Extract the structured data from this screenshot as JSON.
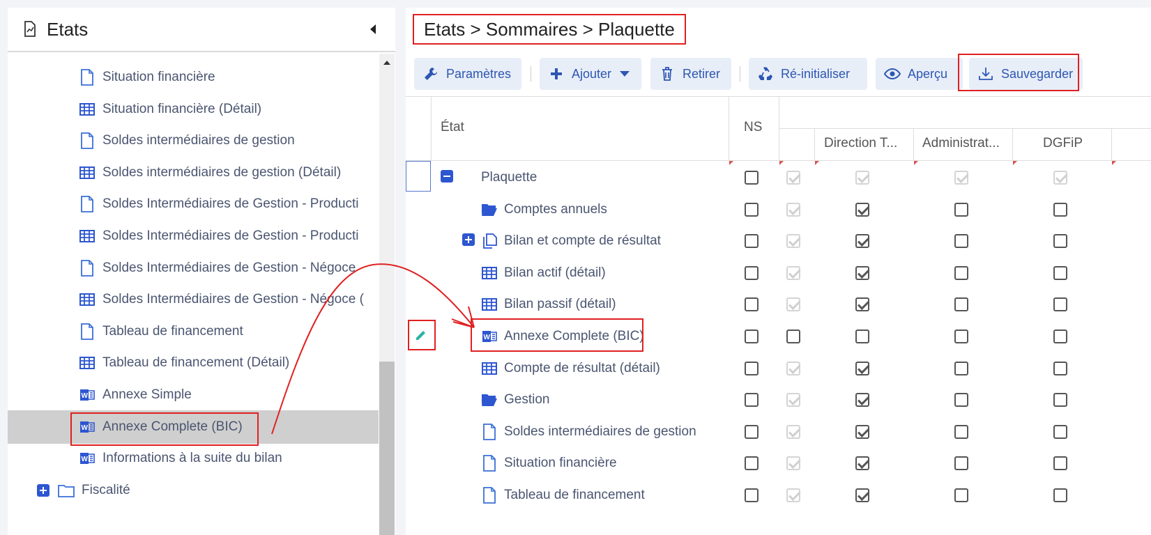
{
  "left_panel": {
    "title": "Etats",
    "items": [
      {
        "label": "Situation financière",
        "icon": "document-icon",
        "indent": 1
      },
      {
        "label": "Situation financière (Détail)",
        "icon": "table-icon",
        "indent": 1
      },
      {
        "label": "Soldes intermédiaires de gestion",
        "icon": "document-icon",
        "indent": 1
      },
      {
        "label": "Soldes intermédiaires de gestion (Détail)",
        "icon": "table-icon",
        "indent": 1
      },
      {
        "label": "Soldes Intermédiaires de Gestion - Producti",
        "icon": "document-icon",
        "indent": 1
      },
      {
        "label": "Soldes Intermédiaires de Gestion - Producti",
        "icon": "table-icon",
        "indent": 1
      },
      {
        "label": "Soldes Intermédiaires de Gestion - Négoce",
        "icon": "document-icon",
        "indent": 1
      },
      {
        "label": "Soldes Intermédiaires de Gestion - Négoce (",
        "icon": "table-icon",
        "indent": 1
      },
      {
        "label": "Tableau de financement",
        "icon": "document-icon",
        "indent": 1
      },
      {
        "label": "Tableau de financement (Détail)",
        "icon": "table-icon",
        "indent": 1
      },
      {
        "label": "Annexe Simple",
        "icon": "word-icon",
        "indent": 1
      },
      {
        "label": "Annexe Complete (BIC)",
        "icon": "word-icon",
        "indent": 1,
        "selected": true
      },
      {
        "label": "Informations à la suite du bilan",
        "icon": "word-icon",
        "indent": 1
      },
      {
        "label": "Fiscalité",
        "icon": "folder-icon",
        "indent": 0,
        "expandable": true
      }
    ]
  },
  "breadcrumb": "Etats > Sommaires > Plaquette",
  "toolbar": {
    "params": "Paramètres",
    "add": "Ajouter",
    "remove": "Retirer",
    "reset": "Ré-initialiser",
    "preview": "Aperçu",
    "save": "Sauvegarder"
  },
  "grid": {
    "col_state": "État",
    "col_ns": "NS",
    "col_groups": [
      "Direction T...",
      "Administrat...",
      "DGFiP"
    ],
    "rows": [
      {
        "label": "Plaquette",
        "icon": "none",
        "expander": "minus",
        "level": 0,
        "ns": false,
        "c1": "disabled",
        "c2": "disabled",
        "c3": "disabled",
        "c4": "disabled"
      },
      {
        "label": "Comptes annuels",
        "icon": "folder-open-icon",
        "level": 1,
        "ns": false,
        "c1": "disabled",
        "c2": "checked",
        "c3": "unchecked",
        "c4": "unchecked"
      },
      {
        "label": "Bilan et compte de résultat",
        "icon": "copy-icon",
        "expander": "plus",
        "level": 1,
        "ns": false,
        "c1": "disabled",
        "c2": "checked",
        "c3": "unchecked",
        "c4": "unchecked"
      },
      {
        "label": "Bilan actif (détail)",
        "icon": "table-icon",
        "level": 1,
        "ns": false,
        "c1": "disabled",
        "c2": "checked",
        "c3": "unchecked",
        "c4": "unchecked"
      },
      {
        "label": "Bilan passif (détail)",
        "icon": "table-icon",
        "level": 1,
        "ns": false,
        "c1": "disabled",
        "c2": "checked",
        "c3": "unchecked",
        "c4": "unchecked"
      },
      {
        "label": "Annexe Complete (BIC)",
        "icon": "word-icon",
        "level": 1,
        "ns": false,
        "c1": "unchecked",
        "c2": "unchecked",
        "c3": "unchecked",
        "c4": "unchecked",
        "editing": true
      },
      {
        "label": "Compte de résultat (détail)",
        "icon": "table-icon",
        "level": 1,
        "ns": false,
        "c1": "disabled",
        "c2": "checked",
        "c3": "unchecked",
        "c4": "unchecked"
      },
      {
        "label": "Gestion",
        "icon": "folder-open-icon",
        "level": 1,
        "ns": false,
        "c1": "disabled",
        "c2": "checked",
        "c3": "unchecked",
        "c4": "unchecked"
      },
      {
        "label": "Soldes intermédiaires de gestion",
        "icon": "document-icon",
        "level": 1,
        "ns": false,
        "c1": "disabled",
        "c2": "checked",
        "c3": "unchecked",
        "c4": "unchecked"
      },
      {
        "label": "Situation financière",
        "icon": "document-icon",
        "level": 1,
        "ns": false,
        "c1": "disabled",
        "c2": "checked",
        "c3": "unchecked",
        "c4": "unchecked"
      },
      {
        "label": "Tableau de financement",
        "icon": "document-icon",
        "level": 1,
        "ns": false,
        "c1": "disabled",
        "c2": "checked",
        "c3": "unchecked",
        "c4": "unchecked"
      }
    ]
  },
  "colors": {
    "accent": "#2d56b3",
    "highlight": "#e02020",
    "selected_bg": "#cfcfcf"
  }
}
